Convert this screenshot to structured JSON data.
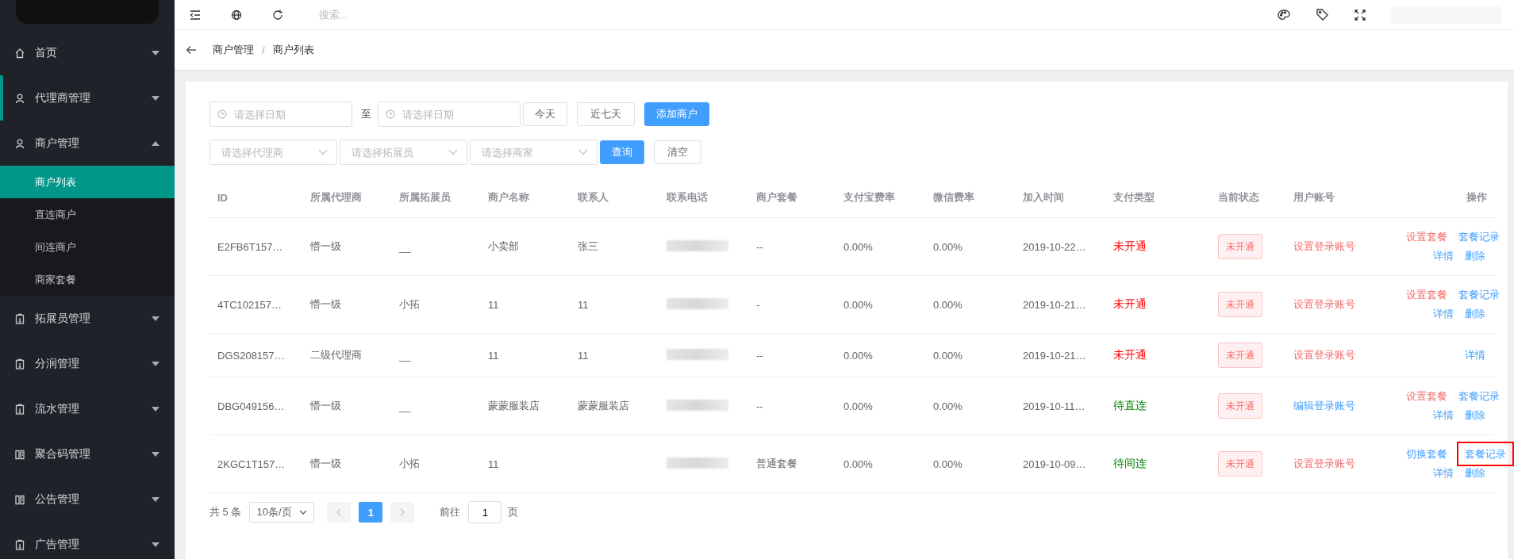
{
  "topbar": {
    "search": {
      "placeholder": "搜索..."
    }
  },
  "sidebar": {
    "items": [
      {
        "label": "首页",
        "expanded": false,
        "hovered": false
      },
      {
        "label": "代理商管理",
        "expanded": false,
        "hovered": true
      },
      {
        "label": "商户管理",
        "expanded": true,
        "hovered": false,
        "children": [
          {
            "label": "商户列表",
            "selected": true
          },
          {
            "label": "直连商户",
            "selected": false
          },
          {
            "label": "间连商户",
            "selected": false
          },
          {
            "label": "商家套餐",
            "selected": false
          }
        ]
      },
      {
        "label": "拓展员管理",
        "expanded": false,
        "hovered": false
      },
      {
        "label": "分润管理",
        "expanded": false,
        "hovered": false
      },
      {
        "label": "流水管理",
        "expanded": false,
        "hovered": false
      },
      {
        "label": "聚合码管理",
        "expanded": false,
        "hovered": false
      },
      {
        "label": "公告管理",
        "expanded": false,
        "hovered": false
      },
      {
        "label": "广告管理",
        "expanded": false,
        "hovered": false
      }
    ]
  },
  "breadcrumb": {
    "items": [
      "商户管理",
      "商户列表"
    ],
    "separator": "/"
  },
  "filters": {
    "start_date": {
      "placeholder": "请选择日期"
    },
    "separator": "至",
    "end_date": {
      "placeholder": "请选择日期"
    },
    "today_button": "今天",
    "week_button": "近七天",
    "add_button": "添加商户",
    "agent_select": {
      "placeholder": "请选择代理商"
    },
    "promoter_select": {
      "placeholder": "请选择拓展员"
    },
    "merchant_select": {
      "placeholder": "请选择商家"
    },
    "query_button": "查询",
    "clear_button": "清空"
  },
  "table": {
    "columns": [
      "ID",
      "所属代理商",
      "所属拓展员",
      "商户名称",
      "联系人",
      "联系电话",
      "商户套餐",
      "支付宝费率",
      "微信费率",
      "加入时间",
      "支付类型",
      "当前状态",
      "用户账号",
      "操作"
    ],
    "rows": [
      {
        "id": "E2FB6T157…",
        "agent": "懵一级",
        "promoter": "__",
        "name": "小卖部",
        "contact": "张三",
        "package": "--",
        "alipay_rate": "0.00%",
        "wechat_rate": "0.00%",
        "joined": "2019-10-22…",
        "pay_type": {
          "text": "未开通",
          "color": "#ff0000"
        },
        "status": "未开通",
        "account": {
          "text": "设置登录账号",
          "color": "#f56c6c"
        },
        "action_rows": [
          {
            "links": [
              {
                "text": "设置套餐",
                "kind": "danger",
                "highlighted": false
              },
              {
                "text": "套餐记录",
                "kind": "primary",
                "highlighted": false
              }
            ]
          },
          {
            "links": [
              {
                "text": "详情",
                "kind": "primary",
                "highlighted": false
              },
              {
                "text": "删除",
                "kind": "primary",
                "highlighted": false
              }
            ]
          }
        ]
      },
      {
        "id": "4TC102157…",
        "agent": "懵一级",
        "promoter": "小拓",
        "name": "11",
        "contact": "11",
        "package": "-",
        "alipay_rate": "0.00%",
        "wechat_rate": "0.00%",
        "joined": "2019-10-21…",
        "pay_type": {
          "text": "未开通",
          "color": "#ff0000"
        },
        "status": "未开通",
        "account": {
          "text": "设置登录账号",
          "color": "#f56c6c"
        },
        "action_rows": [
          {
            "links": [
              {
                "text": "设置套餐",
                "kind": "danger",
                "highlighted": false
              },
              {
                "text": "套餐记录",
                "kind": "primary",
                "highlighted": false
              }
            ]
          },
          {
            "links": [
              {
                "text": "详情",
                "kind": "primary",
                "highlighted": false
              },
              {
                "text": "删除",
                "kind": "primary",
                "highlighted": false
              }
            ]
          }
        ]
      },
      {
        "id": "DGS208157…",
        "agent": "二级代理商",
        "promoter": "__",
        "name": "11",
        "contact": "11",
        "package": "--",
        "alipay_rate": "0.00%",
        "wechat_rate": "0.00%",
        "joined": "2019-10-21…",
        "pay_type": {
          "text": "未开通",
          "color": "#ff0000"
        },
        "status": "未开通",
        "account": {
          "text": "设置登录账号",
          "color": "#f56c6c"
        },
        "action_rows": [
          {
            "links": [
              {
                "text": "详情",
                "kind": "primary",
                "highlighted": false
              }
            ]
          }
        ]
      },
      {
        "id": "DBG049156…",
        "agent": "懵一级",
        "promoter": "__",
        "name": "蒙蒙服装店",
        "contact": "蒙蒙服装店",
        "package": "--",
        "alipay_rate": "0.00%",
        "wechat_rate": "0.00%",
        "joined": "2019-10-11…",
        "pay_type": {
          "text": "待直连",
          "color": "#008000"
        },
        "status": "未开通",
        "account": {
          "text": "编辑登录账号",
          "color": "#409eff"
        },
        "action_rows": [
          {
            "links": [
              {
                "text": "设置套餐",
                "kind": "danger",
                "highlighted": false
              },
              {
                "text": "套餐记录",
                "kind": "primary",
                "highlighted": false
              }
            ]
          },
          {
            "links": [
              {
                "text": "详情",
                "kind": "primary",
                "highlighted": false
              },
              {
                "text": "删除",
                "kind": "primary",
                "highlighted": false
              }
            ]
          }
        ]
      },
      {
        "id": "2KGC1T157…",
        "agent": "懵一级",
        "promoter": "小拓",
        "name": "11",
        "contact": "",
        "package": "普通套餐",
        "alipay_rate": "0.00%",
        "wechat_rate": "0.00%",
        "joined": "2019-10-09…",
        "pay_type": {
          "text": "待间连",
          "color": "#008000"
        },
        "status": "未开通",
        "account": {
          "text": "设置登录账号",
          "color": "#f56c6c"
        },
        "action_rows": [
          {
            "links": [
              {
                "text": "切换套餐",
                "kind": "primary",
                "highlighted": false
              },
              {
                "text": "套餐记录",
                "kind": "primary",
                "highlighted": true
              }
            ]
          },
          {
            "links": [
              {
                "text": "详情",
                "kind": "primary",
                "highlighted": false
              },
              {
                "text": "删除",
                "kind": "primary",
                "highlighted": false
              }
            ]
          }
        ]
      }
    ]
  },
  "pagination": {
    "total": "共 5 条",
    "page_size": "10条/页",
    "pages": [
      {
        "label": "1",
        "selected": true
      }
    ],
    "goto_label": "前往",
    "goto_value": "1",
    "goto_suffix": "页"
  }
}
